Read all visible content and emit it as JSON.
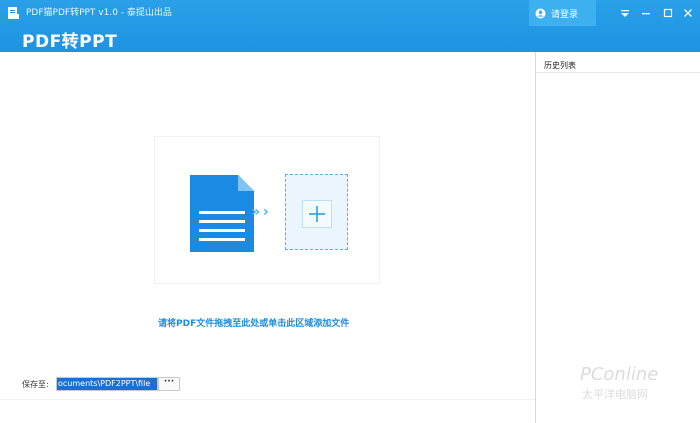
{
  "window": {
    "title": "PDF猫PDF转PPT v1.0 - 泰提山出品",
    "heading": "PDF转PPT"
  },
  "header": {
    "login_label": "请登录",
    "controls": [
      "menu-icon",
      "minimize-icon",
      "maximize-icon",
      "close-icon"
    ]
  },
  "main": {
    "drop_hint": "请将PDF文件拖拽至此处或单击此区域添加文件",
    "arrows": "» ›",
    "save_label": "保存至:",
    "save_path": "ocuments\\PDF2PPT\\file",
    "browse_label": "···"
  },
  "sidebar": {
    "title": "历史列表"
  },
  "watermark": {
    "brand": "PConline",
    "sub": "太平洋电脑网"
  },
  "colors": {
    "header": "#1e93e2",
    "accent": "#1f8ddc",
    "doc_icon": "#1a8ae2"
  }
}
